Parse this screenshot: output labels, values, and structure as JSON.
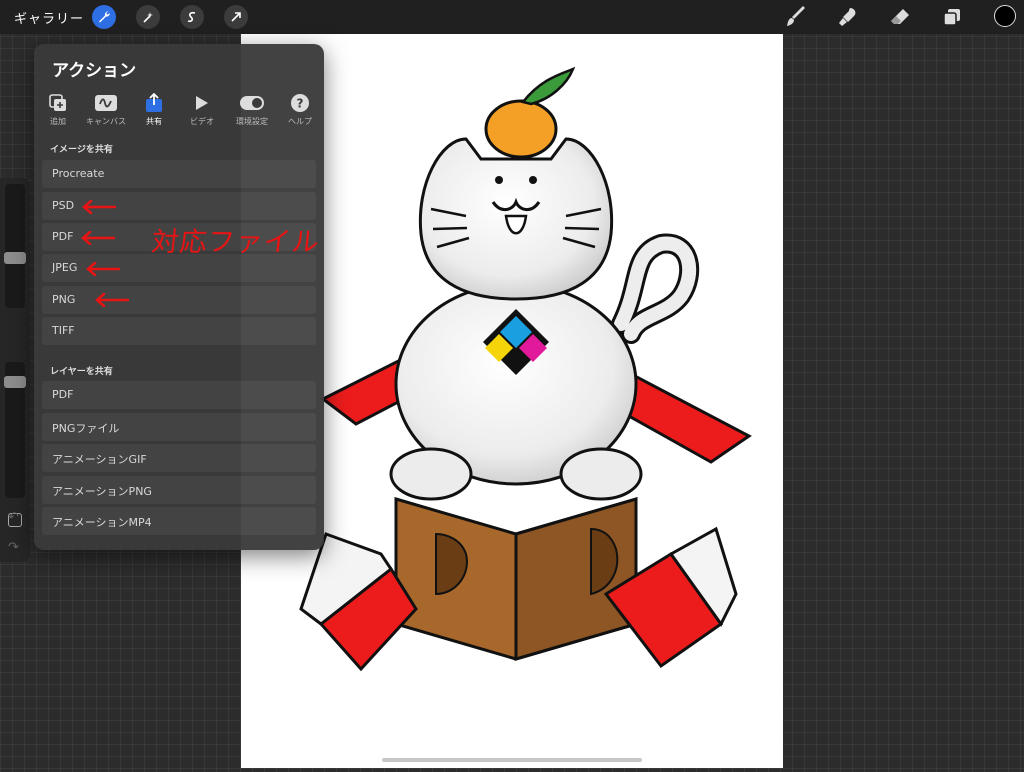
{
  "topbar": {
    "gallery_label": "ギャラリー",
    "left_tools": [
      "wrench-icon",
      "magic-wand-icon",
      "selection-icon",
      "transform-arrow-icon"
    ],
    "right_tools": [
      "brush-icon",
      "smudge-icon",
      "eraser-icon",
      "layers-icon",
      "color-swatch"
    ],
    "active_color": "#000000",
    "accent_color": "#2f6fe4"
  },
  "panel": {
    "title": "アクション",
    "tabs": [
      {
        "label": "追加",
        "icon": "add-image-icon"
      },
      {
        "label": "キャンバス",
        "icon": "canvas-icon"
      },
      {
        "label": "共有",
        "icon": "share-icon",
        "active": true
      },
      {
        "label": "ビデオ",
        "icon": "play-icon"
      },
      {
        "label": "環境設定",
        "icon": "toggle-icon"
      },
      {
        "label": "ヘルプ",
        "icon": "help-icon"
      }
    ],
    "share_image": {
      "heading": "イメージを共有",
      "items": [
        "Procreate",
        "PSD",
        "PDF",
        "JPEG",
        "PNG",
        "TIFF"
      ]
    },
    "share_layers": {
      "heading": "レイヤーを共有",
      "items": [
        "PDF",
        "PNGファイル",
        "アニメーションGIF",
        "アニメーションPNG",
        "アニメーションMP4"
      ]
    }
  },
  "annotation": {
    "text": "対応ファイル",
    "color": "#e81414"
  }
}
